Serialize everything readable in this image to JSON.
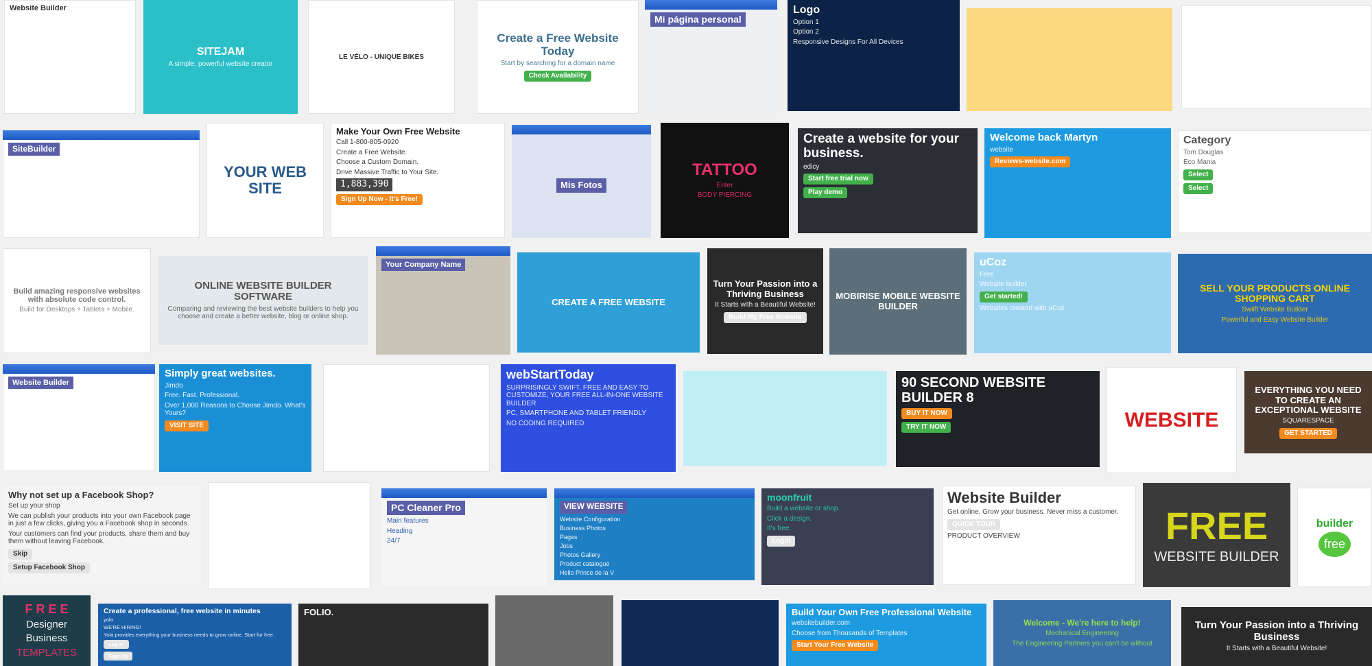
{
  "page": {
    "background": "#f1f1f1"
  },
  "results": [
    {
      "title": "Website Builder",
      "lines": [],
      "bg": "#ffffff",
      "fg": "#333333",
      "kind": "template-gallery"
    },
    {
      "title": "SITEJAM",
      "lines": [
        "A simple, powerful website creator"
      ],
      "bg": "#2bbfc8",
      "fg": "#ffffff",
      "kind": "landing-page"
    },
    {
      "title": "LE VÉLO - UNIQUE BIKES",
      "lines": [],
      "bg": "#ffffff",
      "fg": "#333333",
      "kind": "devices"
    },
    {
      "title": "Create a Free Website Today",
      "lines": [
        "Start by searching for a domain name",
        "Check Availability"
      ],
      "bg": "#ffffff",
      "fg": "#3a6e8a",
      "kind": "landing-page"
    },
    {
      "title": "Mi página personal",
      "lines": [],
      "bg": "#eef0f4",
      "fg": "#ffffff",
      "kind": "browser-window"
    },
    {
      "title": "Logo",
      "lines": [
        "Option 1",
        "Option 2",
        "Responsive Designs For All Devices"
      ],
      "bg": "#0c2347",
      "fg": "#ffffff",
      "kind": "devices"
    },
    {
      "title": "",
      "lines": [],
      "bg": "#fcd980",
      "fg": "#333333",
      "kind": "illustration"
    },
    {
      "title": "",
      "lines": [],
      "bg": "#ffffff",
      "fg": "#333333",
      "kind": "photo"
    },
    {
      "title": "SiteBuilder",
      "lines": [],
      "bg": "#ffffff",
      "fg": "#ffffff",
      "kind": "app-window"
    },
    {
      "title": "YOUR WEB SITE",
      "lines": [],
      "bg": "#ffffff",
      "fg": "#2b5b8a",
      "kind": "illustration"
    },
    {
      "title": "Make Your Own Free Website",
      "lines": [
        "Call 1-800-805-0920",
        "Create a Free Website.",
        "Choose a Custom Domain.",
        "Drive Massive Traffic to Your Site.",
        "1,883,390",
        "Sign Up Now - It's Free!"
      ],
      "bg": "#ffffff",
      "fg": "#222222",
      "kind": "landing-page"
    },
    {
      "title": "Mis Fotos",
      "lines": [],
      "bg": "#dde3f0",
      "fg": "#ffffff",
      "kind": "app-window"
    },
    {
      "title": "TATTOO",
      "lines": [
        "Enter",
        "BODY PIERCING"
      ],
      "bg": "#111111",
      "fg": "#e8306a",
      "kind": "photo"
    },
    {
      "title": "Create a website for your business.",
      "lines": [
        "edicy",
        "Start free trial now",
        "Play demo"
      ],
      "bg": "#2b2f35",
      "fg": "#ffffff",
      "kind": "landing-page"
    },
    {
      "title": "Welcome back Martyn",
      "lines": [
        "website",
        "Reviews-website.com"
      ],
      "bg": "#1e9be0",
      "fg": "#ffffff",
      "kind": "landing-page"
    },
    {
      "title": "Category",
      "lines": [
        "Tom Douglas",
        "Eco Mania",
        "Select",
        "Select"
      ],
      "bg": "#ffffff",
      "fg": "#555555",
      "kind": "template-gallery"
    },
    {
      "title": "Build amazing responsive websites with absolute code control.",
      "lines": [
        "Build for Desktops + Tablets + Mobile."
      ],
      "bg": "#ffffff",
      "fg": "#777777",
      "kind": "devices"
    },
    {
      "title": "ONLINE WEBSITE BUILDER SOFTWARE",
      "lines": [
        "Comparing and reviewing the best website builders to help you choose and create a better website, blog or online shop."
      ],
      "bg": "#e2e8ec",
      "fg": "#555555",
      "kind": "illustration"
    },
    {
      "title": "Your Company Name",
      "lines": [],
      "bg": "#c9c4b8",
      "fg": "#ffffff",
      "kind": "app-window"
    },
    {
      "title": "CREATE A FREE WEBSITE",
      "lines": [],
      "bg": "#2f9fd8",
      "fg": "#ffffff",
      "kind": "editor"
    },
    {
      "title": "Turn Your Passion into a Thriving Business",
      "lines": [
        "It Starts with a Beautiful Website!",
        "Build My Free Website"
      ],
      "bg": "#2a2a2a",
      "fg": "#ffffff",
      "kind": "landing-page"
    },
    {
      "title": "MOBIRISE MOBILE WEBSITE BUILDER",
      "lines": [],
      "bg": "#5c6f78",
      "fg": "#ffffff",
      "kind": "landing-page"
    },
    {
      "title": "uCoz",
      "lines": [
        "Free",
        "Website builder",
        "Get started!",
        "Websites created with uCoz"
      ],
      "bg": "#9ed6f2",
      "fg": "#ffffff",
      "kind": "landing-page"
    },
    {
      "title": "SELL YOUR PRODUCTS ONLINE SHOPPING CART",
      "lines": [
        "Swiift Website Builder",
        "Powerful and Easy Website Builder"
      ],
      "bg": "#2e6ab0",
      "fg": "#f5d400",
      "kind": "landing-page"
    },
    {
      "title": "Website Builder",
      "lines": [],
      "bg": "#ffffff",
      "fg": "#ffffff",
      "kind": "app-window"
    },
    {
      "title": "Simply great websites.",
      "lines": [
        "Jimdo",
        "Free. Fast. Professional.",
        "Over 1,000 Reasons to Choose Jimdo. What's Yours?",
        "VISIT SITE"
      ],
      "bg": "#1b8fd6",
      "fg": "#ffffff",
      "kind": "landing-page"
    },
    {
      "title": "",
      "lines": [],
      "bg": "#ffffff",
      "fg": "#333333",
      "kind": "template-gallery"
    },
    {
      "title": "webStartToday",
      "lines": [
        "SURPRISINGLY SWIFT, FREE AND EASY TO CUSTOMIZE, YOUR FREE ALL-IN-ONE WEBSITE BUILDER",
        "PC, SMARTPHONE AND TABLET FRIENDLY",
        "NO CODING REQUIRED"
      ],
      "bg": "#2e4fe0",
      "fg": "#ffffff",
      "kind": "illustration"
    },
    {
      "title": "",
      "lines": [],
      "bg": "#bfeef5",
      "fg": "#333333",
      "kind": "illustration"
    },
    {
      "title": "90 SECOND WEBSITE BUILDER 8",
      "lines": [
        "BUY IT NOW",
        "TRY IT NOW"
      ],
      "bg": "#1f2226",
      "fg": "#ffffff",
      "kind": "landing-page"
    },
    {
      "title": "WEBSITE",
      "lines": [],
      "bg": "#ffffff",
      "fg": "#d61f1f",
      "kind": "illustration"
    },
    {
      "title": "EVERYTHING YOU NEED TO CREATE AN EXCEPTIONAL WEBSITE",
      "lines": [
        "SQUARESPACE",
        "GET STARTED"
      ],
      "bg": "#4a3a30",
      "fg": "#ffffff",
      "kind": "landing-page"
    },
    {
      "title": "Why not set up a Facebook Shop?",
      "lines": [
        "Set up your shop",
        "We can publish your products into your own Facebook page in just a few clicks, giving you a Facebook shop in seconds.",
        "Your customers can find your products, share them and buy them without leaving Facebook.",
        "Skip",
        "Setup Facebook Shop"
      ],
      "bg": "#f4f4f4",
      "fg": "#333333",
      "kind": "dialog"
    },
    {
      "title": "",
      "lines": [],
      "bg": "#ffffff",
      "fg": "#333333",
      "kind": "devices"
    },
    {
      "title": "PC Cleaner Pro",
      "lines": [
        "Main features",
        "Heading",
        "24/7"
      ],
      "bg": "#f5f5f5",
      "fg": "#1a4fa0",
      "kind": "app-window"
    },
    {
      "title": "VIEW WEBSITE",
      "lines": [
        "Website Configuration",
        "Business Photos",
        "Pages",
        "Jobs",
        "Photos Gallery",
        "Product catalogue",
        "Hello Prince de la V"
      ],
      "bg": "#1f7fc4",
      "fg": "#ffffff",
      "kind": "app-window"
    },
    {
      "title": "moonfruit",
      "lines": [
        "Build a website or shop.",
        "Click a design.",
        "It's free.",
        "Login"
      ],
      "bg": "#3b3f52",
      "fg": "#2ad4b0",
      "kind": "landing-page"
    },
    {
      "title": "Website Builder",
      "lines": [
        "Get online. Grow your business. Never miss a customer.",
        "QUICK TOUR",
        "PRODUCT OVERVIEW"
      ],
      "bg": "#ffffff",
      "fg": "#333333",
      "kind": "landing-page"
    },
    {
      "title": "FREE",
      "lines": [
        "WEBSITE BUILDER"
      ],
      "bg": "#3a3a3a",
      "fg": "#d6d61a",
      "kind": "banner"
    },
    {
      "title": "builder",
      "lines": [
        "free"
      ],
      "bg": "#ffffff",
      "fg": "#2ea82e",
      "kind": "product-box"
    },
    {
      "title": "F R E E",
      "lines": [
        "Designer",
        "Business",
        "TEMPLATES"
      ],
      "bg": "#1e3d48",
      "fg": "#e8306a",
      "kind": "banner"
    },
    {
      "title": "Create a professional, free website in minutes",
      "lines": [
        "yola",
        "WE'RE HIRING!",
        "Yola provides everything your business needs to grow online. Start for free.",
        "Log In",
        "Sign Up"
      ],
      "bg": "#1b5fa8",
      "fg": "#ffffff",
      "kind": "landing-page"
    },
    {
      "title": "FOLIO.",
      "lines": [],
      "bg": "#2b2b2b",
      "fg": "#ffffff",
      "kind": "editor"
    },
    {
      "title": "",
      "lines": [],
      "bg": "#6a6a6a",
      "fg": "#ffffff",
      "kind": "photo"
    },
    {
      "title": "",
      "lines": [],
      "bg": "#0d2a55",
      "fg": "#ffffff",
      "kind": "photo"
    },
    {
      "title": "Build Your Own Free Professional Website",
      "lines": [
        "websitebuilder.com",
        "Choose from Thousands of Templates",
        "Start Your Free Website"
      ],
      "bg": "#1e9be0",
      "fg": "#ffffff",
      "kind": "landing-page"
    },
    {
      "title": "Welcome - We're here to help!",
      "lines": [
        "Mechanical Engineering",
        "The Engineering Partners you can't be without"
      ],
      "bg": "#3a6fa8",
      "fg": "#9ae04a",
      "kind": "devices"
    },
    {
      "title": "Turn Your Passion into a Thriving Business",
      "lines": [
        "It Starts with a Beautiful Website!"
      ],
      "bg": "#2a2a2a",
      "fg": "#ffffff",
      "kind": "landing-page"
    }
  ]
}
